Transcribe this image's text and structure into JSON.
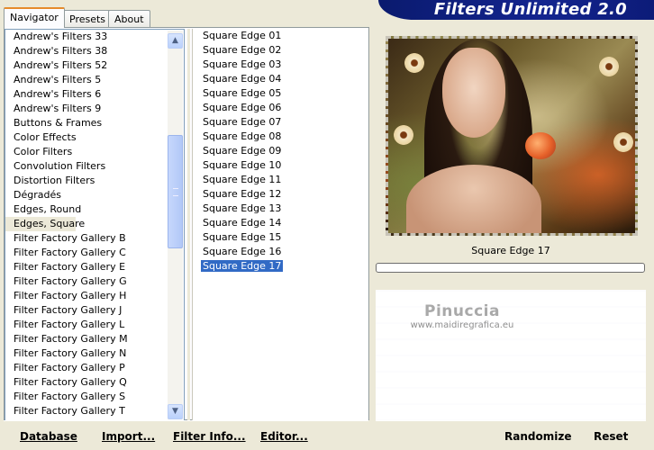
{
  "app": {
    "title": "Filters Unlimited 2.0"
  },
  "tabs": [
    {
      "label": "Navigator"
    },
    {
      "label": "Presets"
    },
    {
      "label": "About"
    }
  ],
  "categories": {
    "items": [
      "Andrew's Filters 33",
      "Andrew's Filters 38",
      "Andrew's Filters 52",
      "Andrew's Filters 5",
      "Andrew's Filters 6",
      "Andrew's Filters 9",
      "Buttons & Frames",
      "Color Effects",
      "Color Filters",
      "Convolution Filters",
      "Distortion Filters",
      "Dégradés",
      "Edges, Round",
      "Edges, Square",
      "Filter Factory Gallery B",
      "Filter Factory Gallery C",
      "Filter Factory Gallery E",
      "Filter Factory Gallery G",
      "Filter Factory Gallery H",
      "Filter Factory Gallery J",
      "Filter Factory Gallery L",
      "Filter Factory Gallery M",
      "Filter Factory Gallery N",
      "Filter Factory Gallery P",
      "Filter Factory Gallery Q",
      "Filter Factory Gallery S",
      "Filter Factory Gallery T"
    ],
    "selected": "Edges, Square"
  },
  "filters": {
    "items": [
      "Square Edge 01",
      "Square Edge 02",
      "Square Edge 03",
      "Square Edge 04",
      "Square Edge 05",
      "Square Edge 06",
      "Square Edge 07",
      "Square Edge 08",
      "Square Edge 09",
      "Square Edge 10",
      "Square Edge 11",
      "Square Edge 12",
      "Square Edge 13",
      "Square Edge 14",
      "Square Edge 15",
      "Square Edge 16",
      "Square Edge 17"
    ],
    "selected": "Square Edge 17"
  },
  "preview": {
    "caption": "Square Edge 17"
  },
  "watermark": {
    "line1": "Pinuccia",
    "line2": "www.maidiregrafica.eu"
  },
  "buttons": {
    "database": "Database",
    "import": "Import...",
    "filter_info": "Filter Info...",
    "editor": "Editor...",
    "randomize": "Randomize",
    "reset": "Reset"
  },
  "icons": {
    "scroll_up": "chevron-up-icon",
    "scroll_down": "chevron-down-icon"
  },
  "colors": {
    "selection": "#316ac5",
    "brand_bar": "#14258f",
    "tab_accent": "#e68b2c"
  }
}
